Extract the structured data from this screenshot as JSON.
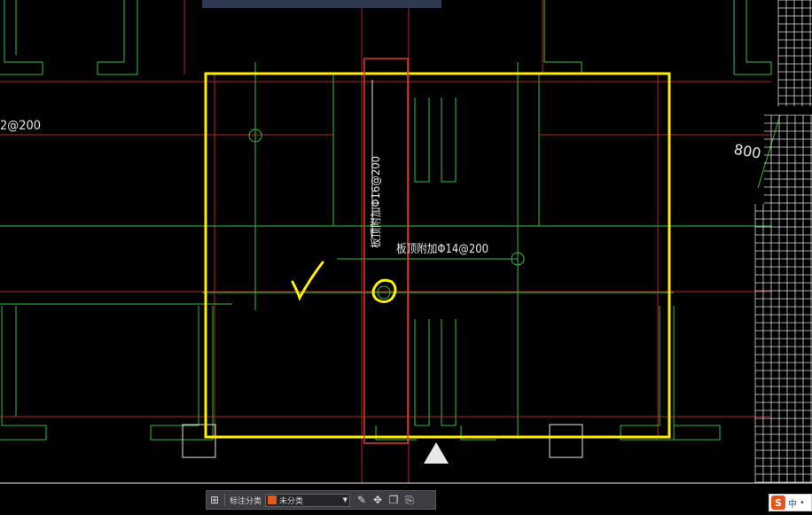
{
  "top_tip": {
    "text": ""
  },
  "drawing": {
    "left_label": "2@200",
    "dim_label": "800",
    "vertical_rebar_label": "板顶附加Φ16@200",
    "horizontal_rebar_label": "板顶附加Φ14@200"
  },
  "annotations": {
    "highlight_color": "#ffee00",
    "selection_color": "#e03a2a"
  },
  "toolbar": {
    "label": "标注分类",
    "select_value": "未分类",
    "swatch_color": "#e05a1a"
  },
  "ime": {
    "logo": "S",
    "mode": "中",
    "dot": "•"
  }
}
